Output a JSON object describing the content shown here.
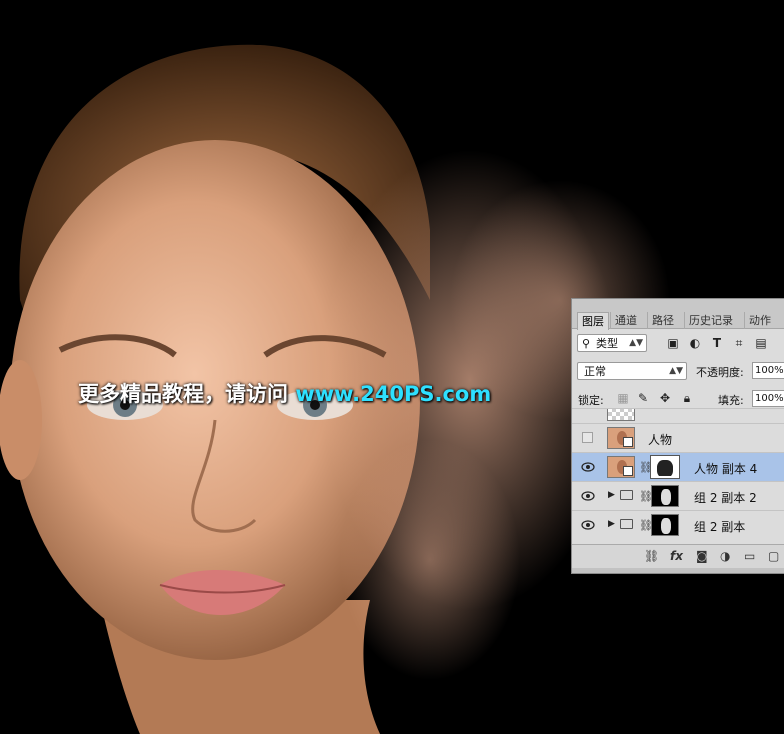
{
  "watermark": {
    "text": "更多精品教程，请访问 ",
    "url": "www.240PS.com"
  },
  "panel": {
    "tabs": [
      {
        "label": "图层",
        "active": true
      },
      {
        "label": "通道",
        "active": false
      },
      {
        "label": "路径",
        "active": false
      },
      {
        "label": "历史记录",
        "active": false
      },
      {
        "label": "动作",
        "active": false
      }
    ],
    "filter": {
      "kind_label": "类型",
      "icons": [
        "image-filter-icon",
        "adjustment-filter-icon",
        "type-filter-icon",
        "shape-filter-icon",
        "smartobject-filter-icon"
      ],
      "type_glyph": "T"
    },
    "blend_mode": "正常",
    "opacity": {
      "label": "不透明度:",
      "value": "100%"
    },
    "lock": {
      "label": "锁定:"
    },
    "fill": {
      "label": "填充:",
      "value": "100%"
    },
    "layers": [
      {
        "name": "人物",
        "visible": false,
        "selected": false,
        "type": "smart-object"
      },
      {
        "name": "人物 副本 4",
        "visible": true,
        "selected": true,
        "type": "smart-object-mask"
      },
      {
        "name": "组 2 副本 2",
        "visible": true,
        "selected": false,
        "type": "group-mask"
      },
      {
        "name": "组 2 副本",
        "visible": true,
        "selected": false,
        "type": "group-mask"
      }
    ],
    "bottom": {
      "fx": "fx"
    },
    "colors": {
      "selected_row": "#a9c3e8",
      "panel_bg": "#dcdcdc"
    }
  }
}
